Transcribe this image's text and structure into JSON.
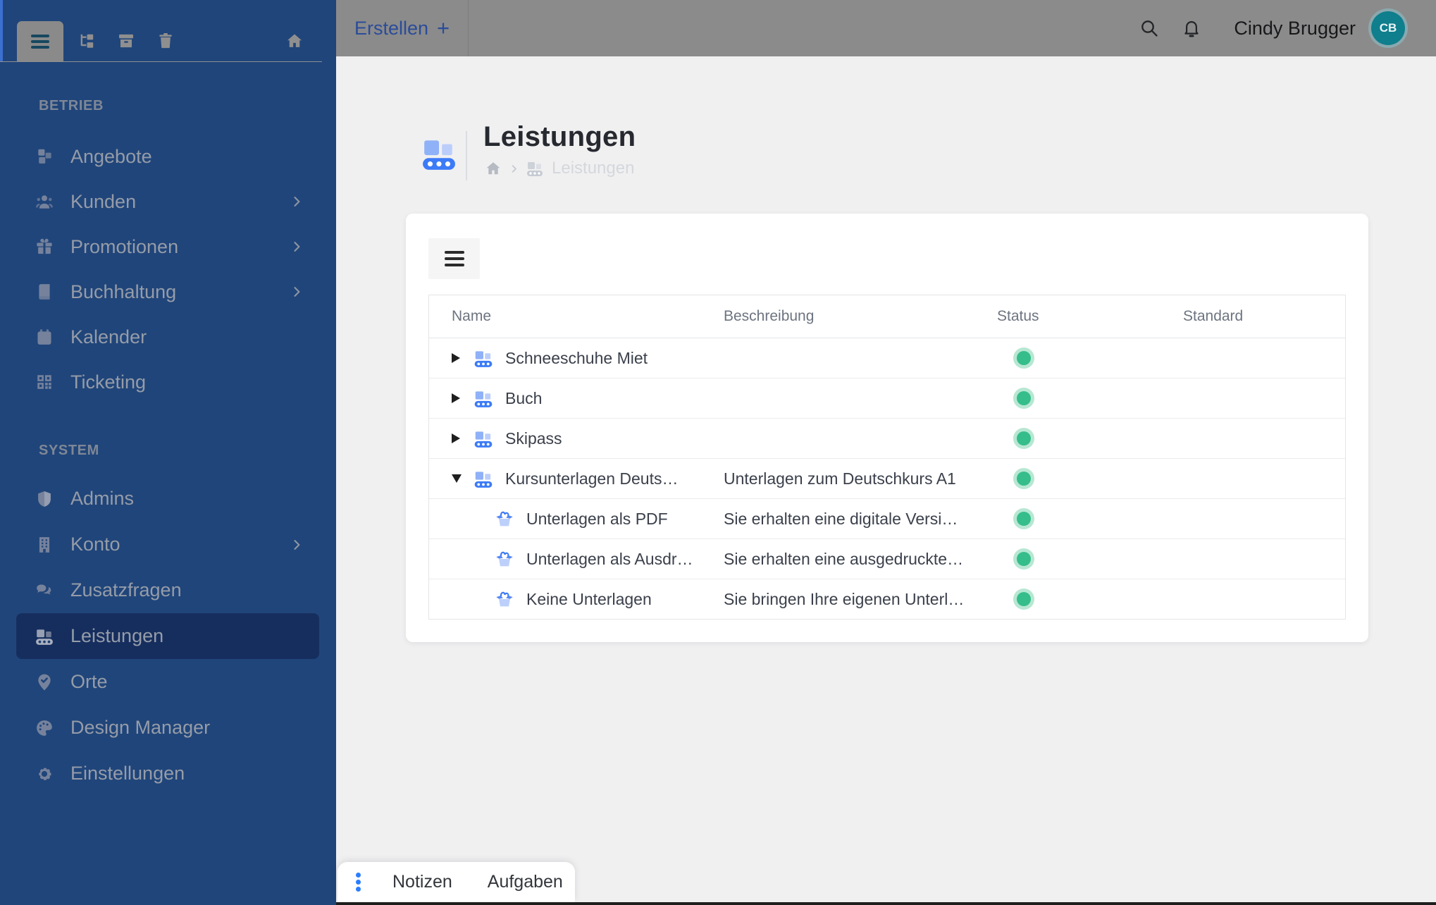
{
  "topbar": {
    "create_label": "Erstellen",
    "create_plus": "+",
    "user_name": "Cindy Brugger",
    "avatar_initials": "CB"
  },
  "window_tabs": {
    "icons": [
      "menu-icon",
      "sitemap-icon",
      "archive-icon",
      "trash-icon",
      "home-icon"
    ]
  },
  "sidebar": {
    "sections": [
      {
        "label": "BETRIEB",
        "items": [
          {
            "label": "Angebote",
            "icon": "cubes-icon",
            "chevron": false,
            "active": false
          },
          {
            "label": "Kunden",
            "icon": "users-icon",
            "chevron": true,
            "active": false
          },
          {
            "label": "Promotionen",
            "icon": "gift-icon",
            "chevron": true,
            "active": false
          },
          {
            "label": "Buchhaltung",
            "icon": "book-icon",
            "chevron": true,
            "active": false
          },
          {
            "label": "Kalender",
            "icon": "calendar-icon",
            "chevron": false,
            "active": false
          },
          {
            "label": "Ticketing",
            "icon": "qr-icon",
            "chevron": false,
            "active": false
          }
        ]
      },
      {
        "label": "SYSTEM",
        "items": [
          {
            "label": "Admins",
            "icon": "shield-icon",
            "chevron": false,
            "active": false
          },
          {
            "label": "Konto",
            "icon": "building-icon",
            "chevron": true,
            "active": false
          },
          {
            "label": "Zusatzfragen",
            "icon": "chat-icon",
            "chevron": false,
            "active": false
          },
          {
            "label": "Leistungen",
            "icon": "conveyor-icon",
            "chevron": false,
            "active": true
          },
          {
            "label": "Orte",
            "icon": "pin-check-icon",
            "chevron": false,
            "active": false
          },
          {
            "label": "Design Manager",
            "icon": "palette-icon",
            "chevron": false,
            "active": false
          },
          {
            "label": "Einstellungen",
            "icon": "gear-icon",
            "chevron": false,
            "active": false
          }
        ]
      }
    ]
  },
  "page": {
    "title": "Leistungen",
    "breadcrumb": {
      "home_icon": "home-icon",
      "item_icon": "conveyor-icon",
      "current": "Leistungen"
    }
  },
  "table": {
    "columns": [
      "Name",
      "Beschreibung",
      "Status",
      "Standard"
    ],
    "rows": [
      {
        "name": "Schneeschuhe Miet",
        "description": "",
        "status": "active",
        "standard": "",
        "level": 0,
        "expander": "collapsed",
        "icon": "conveyor-icon"
      },
      {
        "name": "Buch",
        "description": "",
        "status": "active",
        "standard": "",
        "level": 0,
        "expander": "collapsed",
        "icon": "conveyor-icon"
      },
      {
        "name": "Skipass",
        "description": "",
        "status": "active",
        "standard": "",
        "level": 0,
        "expander": "collapsed",
        "icon": "conveyor-icon"
      },
      {
        "name": "Kursunterlagen Deuts…",
        "description": "Unterlagen zum Deutschkurs A1",
        "status": "active",
        "standard": "",
        "level": 0,
        "expander": "expanded",
        "icon": "conveyor-icon"
      },
      {
        "name": "Unterlagen als PDF",
        "description": "Sie erhalten eine digitale Versi…",
        "status": "active",
        "standard": "",
        "level": 1,
        "expander": "none",
        "icon": "open-box-icon"
      },
      {
        "name": "Unterlagen als Ausdr…",
        "description": "Sie erhalten eine ausgedruckte…",
        "status": "active",
        "standard": "",
        "level": 1,
        "expander": "none",
        "icon": "open-box-icon"
      },
      {
        "name": "Keine Unterlagen",
        "description": "Sie bringen Ihre eigenen Unterl…",
        "status": "active",
        "standard": "",
        "level": 1,
        "expander": "none",
        "icon": "open-box-icon"
      }
    ]
  },
  "footer_tabs": {
    "menu_icon": "kebab-dots-icon",
    "labels": [
      "Notizen",
      "Aufgaben"
    ]
  },
  "colors": {
    "sidebar_bg": "#20457A",
    "sidebar_active_bg": "#162E5E",
    "topbar_bg": "#8B8B8B",
    "accent_blue": "#3C7BF7",
    "create_link_blue": "#2B4C99",
    "status_green": "#35BD8B",
    "status_green_ring": "#B7E7D3",
    "avatar_teal": "#0F7E8D",
    "content_bg": "#F0F0F1"
  }
}
